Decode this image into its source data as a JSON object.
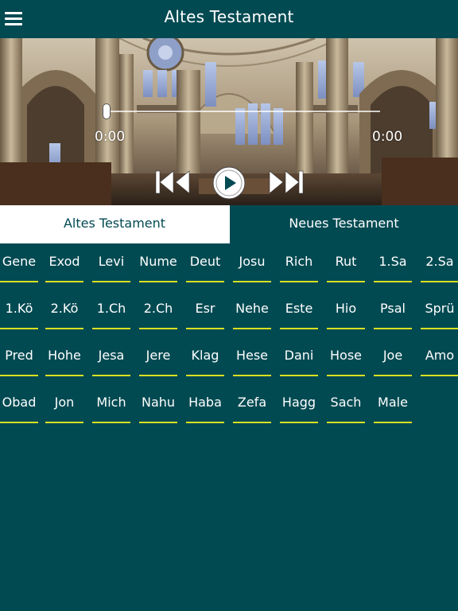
{
  "header": {
    "title": "Altes Testament",
    "menu_icon": "hamburger-menu-icon"
  },
  "player": {
    "elapsed": "0:00",
    "total": "0:00",
    "progress": 0,
    "prev_icon": "skip-previous-icon",
    "play_icon": "play-icon",
    "next_icon": "skip-next-icon"
  },
  "tabs": [
    {
      "label": "Altes Testament",
      "selected": true
    },
    {
      "label": "Neues Testament",
      "selected": false
    }
  ],
  "books": [
    "Gene",
    "Exod",
    "Levi",
    "Nume",
    "Deut",
    "Josu",
    "Rich",
    "Rut",
    "1.Sa",
    "2.Sa",
    "1.Kö",
    "2.Kö",
    "1.Ch",
    "2.Ch",
    "Esr",
    "Nehe",
    "Este",
    "Hio",
    "Psal",
    "Sprü",
    "Pred",
    "Hohe",
    "Jesa",
    "Jere",
    "Klag",
    "Hese",
    "Dani",
    "Hose",
    "Joe",
    "Amo",
    "Obad",
    "Jon",
    "Mich",
    "Nahu",
    "Haba",
    "Zefa",
    "Hagg",
    "Sach",
    "Male"
  ],
  "colors": {
    "background": "#024a52",
    "tab_selected_bg": "#ffffff",
    "underline": "#d9e021"
  }
}
